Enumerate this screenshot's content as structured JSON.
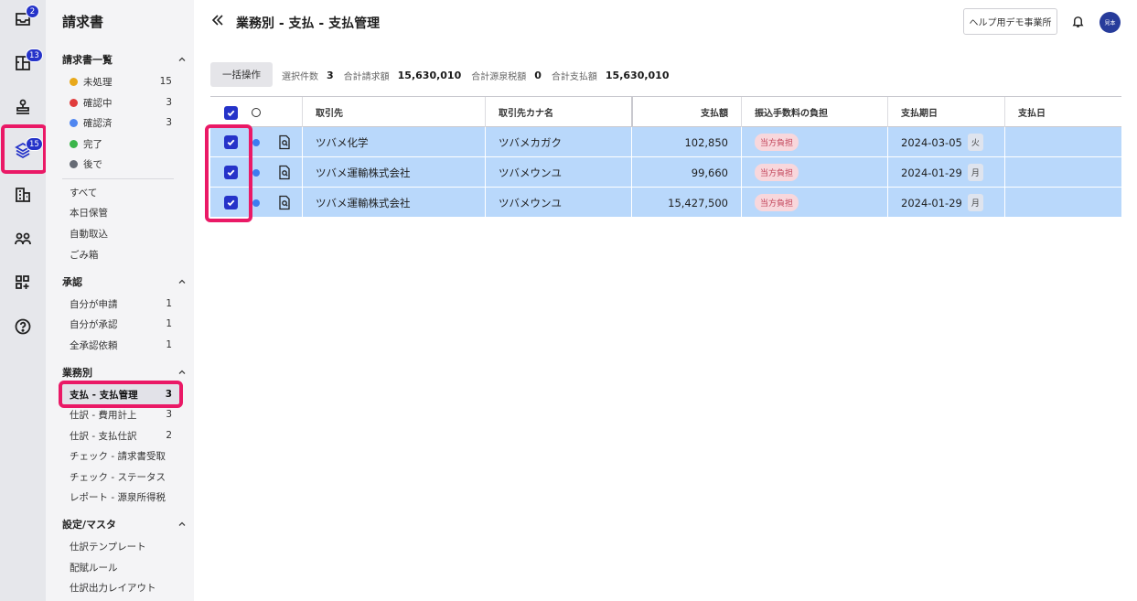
{
  "rail": {
    "inbox_badge": "2",
    "book_badge": "13",
    "layers_badge": "15"
  },
  "sidebar": {
    "title": "請求書",
    "invoice_list": {
      "heading": "請求書一覧",
      "statuses": [
        {
          "label": "未処理",
          "count": "15",
          "color": "#e8a81a"
        },
        {
          "label": "確認中",
          "count": "3",
          "color": "#e03c3c"
        },
        {
          "label": "確認済",
          "count": "3",
          "color": "#4f86f0"
        },
        {
          "label": "完了",
          "count": "",
          "color": "#3bb54a"
        },
        {
          "label": "後で",
          "count": "",
          "color": "#666b75"
        }
      ],
      "others": [
        "すべて",
        "本日保管",
        "自動取込",
        "ごみ箱"
      ]
    },
    "approval": {
      "heading": "承認",
      "items": [
        {
          "label": "自分が申請",
          "count": "1"
        },
        {
          "label": "自分が承認",
          "count": "1"
        },
        {
          "label": "全承認依頼",
          "count": "1"
        }
      ]
    },
    "business": {
      "heading": "業務別",
      "items": [
        {
          "label": "支払 - 支払管理",
          "count": "3"
        },
        {
          "label": "仕訳 - 費用計上",
          "count": "3"
        },
        {
          "label": "仕訳 - 支払仕訳",
          "count": "2"
        },
        {
          "label": "チェック - 請求書受取",
          "count": ""
        },
        {
          "label": "チェック - ステータス",
          "count": ""
        },
        {
          "label": "レポート - 源泉所得税",
          "count": ""
        }
      ]
    },
    "settings": {
      "heading": "設定/マスタ",
      "items": [
        "仕訳テンプレート",
        "配賦ルール",
        "仕訳出力レイアウト"
      ]
    }
  },
  "header": {
    "title": "業務別 - 支払 - 支払管理",
    "help_button": "ヘルプ用デモ事業所",
    "avatar_text": "見本"
  },
  "toolbar": {
    "bulk_button": "一括操作",
    "selected_count_label": "選択件数",
    "selected_count": "3",
    "total_invoice_label": "合計請求額",
    "total_invoice": "15,630,010",
    "total_withholding_label": "合計源泉税額",
    "total_withholding": "0",
    "total_payment_label": "合計支払額",
    "total_payment": "15,630,010"
  },
  "table": {
    "columns": [
      "取引先",
      "取引先カナ名",
      "支払額",
      "振込手数料の負担",
      "支払期日",
      "支払日"
    ],
    "rows": [
      {
        "partner": "ツバメ化学",
        "kana": "ツバメカガク",
        "amount": "102,850",
        "fee": "当方負担",
        "due": "2024-03-05",
        "weekday": "火",
        "paid": ""
      },
      {
        "partner": "ツバメ運輸株式会社",
        "kana": "ツバメウンユ",
        "amount": "99,660",
        "fee": "当方負担",
        "due": "2024-01-29",
        "weekday": "月",
        "paid": ""
      },
      {
        "partner": "ツバメ運輸株式会社",
        "kana": "ツバメウンユ",
        "amount": "15,427,500",
        "fee": "当方負担",
        "due": "2024-01-29",
        "weekday": "月",
        "paid": ""
      }
    ]
  }
}
